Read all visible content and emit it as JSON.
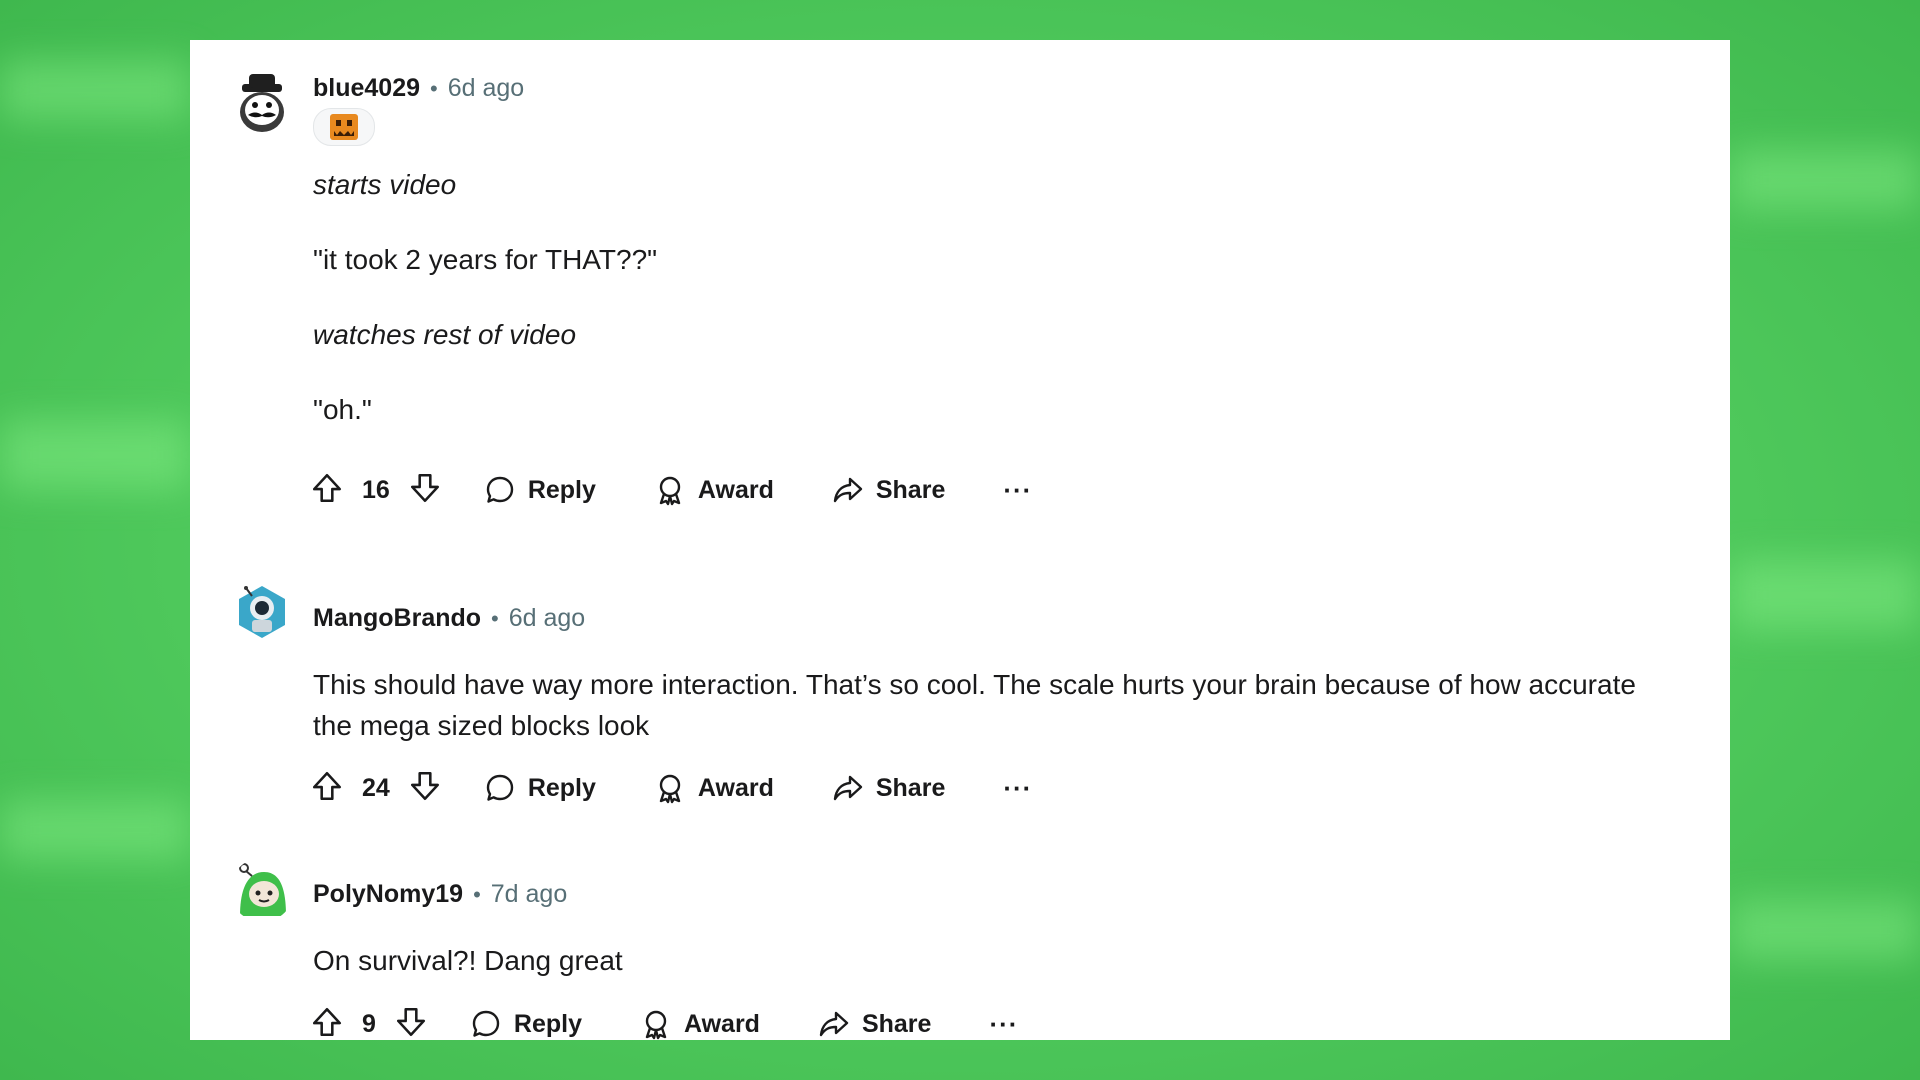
{
  "comments": [
    {
      "username": "blue4029",
      "separator": "•",
      "time": "6d ago",
      "avatar_icon": "mustache-hat-avatar-icon",
      "flair_icon": "pumpkin-flair-icon",
      "body": [
        {
          "text": "starts video",
          "italic": true
        },
        {
          "text": "\"it took 2 years for THAT??\"",
          "italic": false
        },
        {
          "text": "watches rest of video",
          "italic": true
        },
        {
          "text": "\"oh.\"",
          "italic": false
        }
      ],
      "score": "16",
      "actions": {
        "reply": "Reply",
        "award": "Award",
        "share": "Share",
        "more": "···"
      }
    },
    {
      "username": "MangoBrando",
      "separator": "•",
      "time": "6d ago",
      "avatar_icon": "astronaut-avatar-icon",
      "body": [
        {
          "text": "This should have way more interaction. That’s so cool. The scale hurts your brain because of how accurate the mega sized blocks look",
          "italic": false
        }
      ],
      "score": "24",
      "actions": {
        "reply": "Reply",
        "award": "Award",
        "share": "Share",
        "more": "···"
      }
    },
    {
      "username": "PolyNomy19",
      "separator": "•",
      "time": "7d ago",
      "avatar_icon": "green-hood-avatar-icon",
      "body": [
        {
          "text": "On survival?! Dang great",
          "italic": false
        }
      ],
      "score": "9",
      "actions": {
        "reply": "Reply",
        "award": "Award",
        "share": "Share",
        "more": "···"
      }
    }
  ],
  "colors": {
    "background": "#4fc95c",
    "card": "#ffffff",
    "text": "#1a1a1b",
    "meta": "#576f76"
  }
}
